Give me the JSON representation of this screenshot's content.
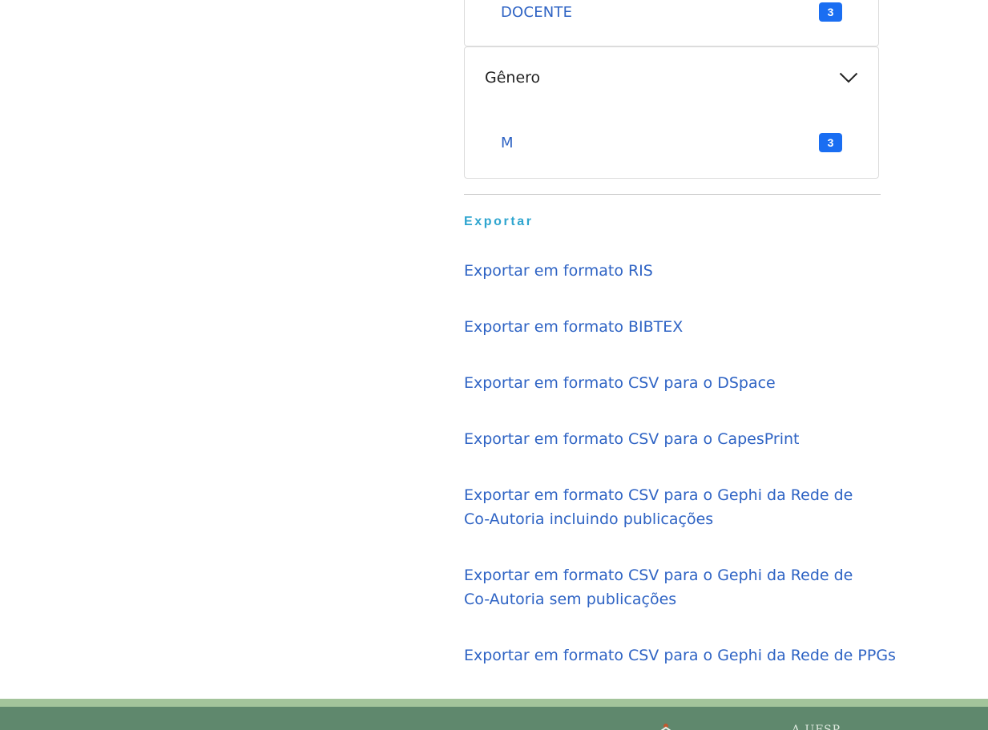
{
  "facets": {
    "vinculo": {
      "items": [
        {
          "label": "DOCENTE",
          "count": "3"
        }
      ]
    },
    "genero": {
      "title": "Gênero",
      "items": [
        {
          "label": "M",
          "count": "3"
        }
      ]
    }
  },
  "export": {
    "heading": "Exportar",
    "links": [
      "Exportar em formato RIS",
      "Exportar em formato BIBTEX",
      "Exportar em formato CSV para o DSpace",
      "Exportar em formato CSV para o CapesPrint",
      "Exportar em formato CSV para o Gephi da Rede de Co-Autoria incluindo publicações",
      "Exportar em formato CSV para o Gephi da Rede de Co-Autoria sem publicações",
      "Exportar em formato CSV para o Gephi da Rede de PPGs"
    ]
  },
  "footer": {
    "text": "A UFSP"
  },
  "colors": {
    "link": "#2e63c4",
    "badge": "#1a6ef2",
    "export_heading": "#2ea5cf",
    "footer_stripe": "#a3c49b",
    "footer_bg": "#5f886d"
  },
  "icons": {
    "facet_toggle": "chevron-down-icon",
    "footer_logo": "institution-logo-icon"
  }
}
